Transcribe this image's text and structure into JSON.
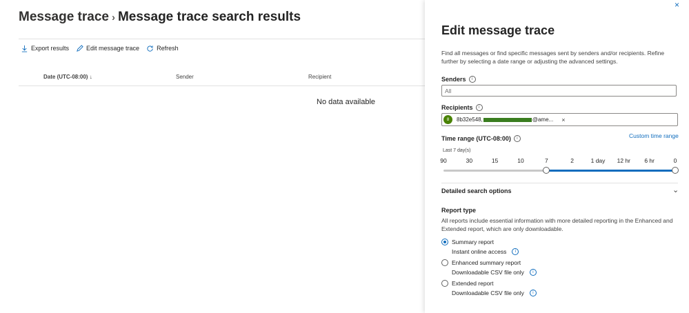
{
  "breadcrumb": {
    "parent": "Message trace",
    "separator": ">",
    "current": "Message trace search results"
  },
  "commands": {
    "export": "Export results",
    "edit": "Edit message trace",
    "refresh": "Refresh"
  },
  "table": {
    "col_date": "Date (UTC-08:00)",
    "col_sender": "Sender",
    "col_recipient": "Recipient",
    "empty": "No data available"
  },
  "panel": {
    "close": "×",
    "title": "Edit message trace",
    "description": "Find all messages or find specific messages sent by senders and/or recipients. Refine further by selecting a date range or adjusting the advanced settings.",
    "senders_label": "Senders",
    "senders_placeholder": "All",
    "recipients_label": "Recipients",
    "recipient_avatar": "8",
    "recipient_prefix": "8b32e548,",
    "recipient_suffix": "@ame...",
    "chip_remove": "×",
    "time_label": "Time range (UTC-08:00)",
    "custom_time": "Custom time range",
    "range_text": "Last 7 day(s)",
    "ticks": [
      "90",
      "30",
      "15",
      "10",
      "7",
      "2",
      "1 day",
      "12 hr",
      "6 hr",
      "0"
    ],
    "range_start_index": 4,
    "range_end_index": 9,
    "detailed": "Detailed search options",
    "report_type_label": "Report type",
    "report_type_desc": "All reports include essential information with more detailed reporting in the Enhanced and Extended report, which are only downloadable.",
    "options": [
      {
        "label": "Summary report",
        "sub": "Instant online access",
        "selected": true
      },
      {
        "label": "Enhanced summary report",
        "sub": "Downloadable CSV file only",
        "selected": false
      },
      {
        "label": "Extended report",
        "sub": "Downloadable CSV file only",
        "selected": false
      }
    ]
  },
  "colors": {
    "accent": "#0f6cbd",
    "avatar": "#498205"
  }
}
